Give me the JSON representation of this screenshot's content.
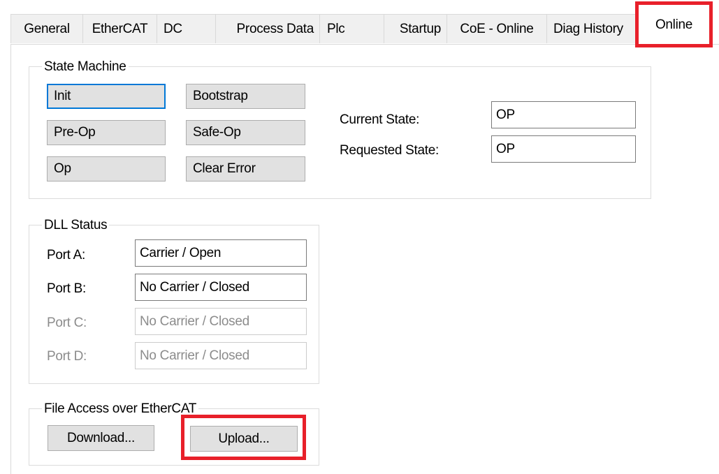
{
  "tabs": [
    "General",
    "EtherCAT",
    "DC",
    "Process Data",
    "Plc",
    "Startup",
    "CoE - Online",
    "Diag History",
    "Online"
  ],
  "state_machine": {
    "legend": "State Machine",
    "buttons": {
      "init": "Init",
      "bootstrap": "Bootstrap",
      "pre_op": "Pre-Op",
      "safe_op": "Safe-Op",
      "op": "Op",
      "clear_error": "Clear Error"
    },
    "current_state_label": "Current State:",
    "current_state_value": "OP",
    "requested_state_label": "Requested State:",
    "requested_state_value": "OP"
  },
  "dll_status": {
    "legend": "DLL Status",
    "ports": [
      {
        "label": "Port A:",
        "value": "Carrier / Open"
      },
      {
        "label": "Port B:",
        "value": "No Carrier / Closed"
      },
      {
        "label": "Port C:",
        "value": "No Carrier / Closed"
      },
      {
        "label": "Port D:",
        "value": "No Carrier / Closed"
      }
    ]
  },
  "file_access": {
    "legend": "File Access over EtherCAT",
    "download_label": "Download...",
    "upload_label": "Upload..."
  },
  "colors": {
    "highlight": "#e8202a",
    "focus": "#0078d7"
  }
}
